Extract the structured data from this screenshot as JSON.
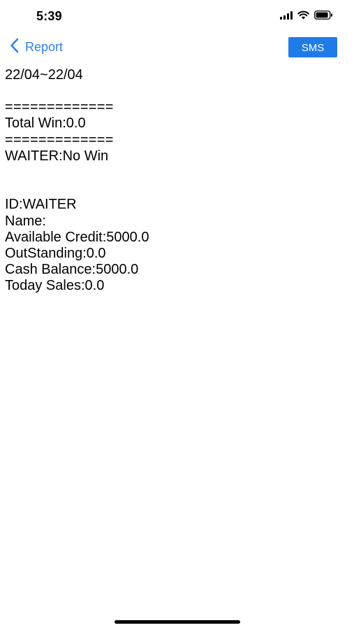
{
  "status_bar": {
    "time": "5:39"
  },
  "nav": {
    "back_label": "Report",
    "sms_label": "SMS"
  },
  "report": {
    "date_range": "22/04~22/04",
    "separator_1": "=============",
    "total_win": "Total Win:0.0",
    "separator_2": "=============",
    "waiter_result": "WAITER:No Win",
    "id": "ID:WAITER",
    "name": "Name:",
    "available_credit": "Available Credit:5000.0",
    "outstanding": "OutStanding:0.0",
    "cash_balance": "Cash Balance:5000.0",
    "today_sales": "Today Sales:0.0"
  },
  "colors": {
    "accent": "#2f80e8",
    "sms_button": "#1f7be8"
  }
}
